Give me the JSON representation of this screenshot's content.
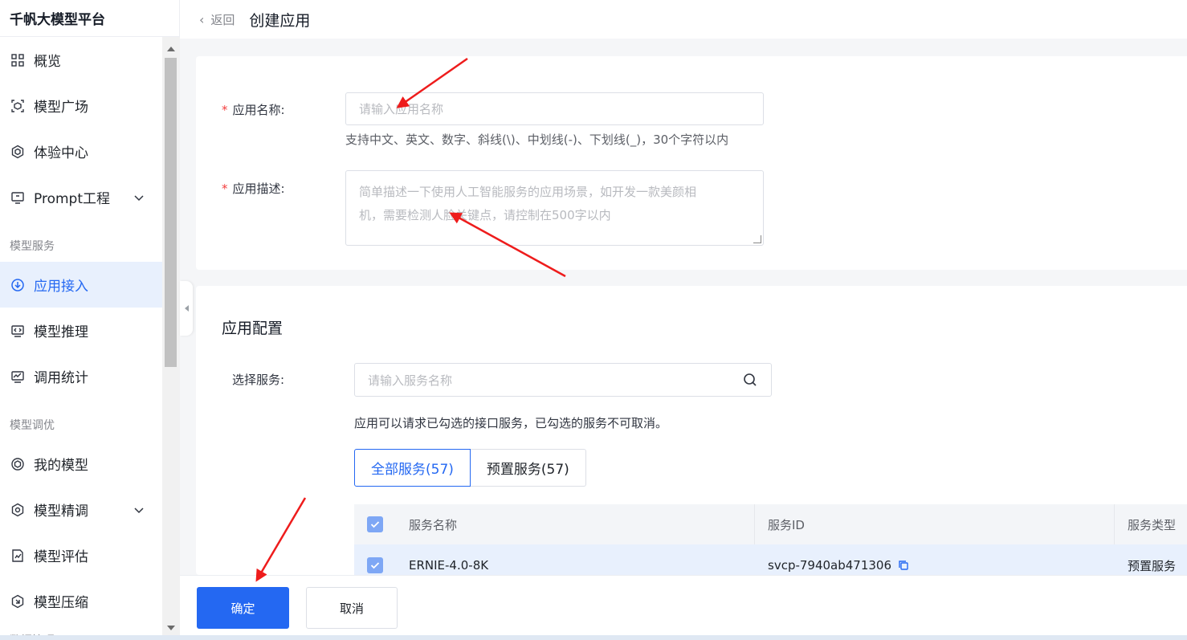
{
  "brand": "千帆大模型平台",
  "sidebar": {
    "items": [
      {
        "label": "概览",
        "icon": "grid-icon"
      },
      {
        "label": "模型广场",
        "icon": "cube-scan-icon"
      },
      {
        "label": "体验中心",
        "icon": "hexagon-icon"
      },
      {
        "label": "Prompt工程",
        "icon": "prompt-icon"
      }
    ],
    "group_service": "模型服务",
    "service_items": [
      {
        "label": "应用接入",
        "icon": "download-circle-icon",
        "active": true
      },
      {
        "label": "模型推理",
        "icon": "code-monitor-icon"
      },
      {
        "label": "调用统计",
        "icon": "chart-monitor-icon"
      }
    ],
    "group_tuning": "模型调优",
    "tuning_items": [
      {
        "label": "我的模型",
        "icon": "model-icon"
      },
      {
        "label": "模型精调",
        "icon": "tune-icon"
      },
      {
        "label": "模型评估",
        "icon": "evaluate-icon"
      },
      {
        "label": "模型压缩",
        "icon": "compress-icon"
      }
    ],
    "group_data": "数据管理"
  },
  "header": {
    "back_label": "返回",
    "title": "创建应用"
  },
  "form": {
    "name_label": "应用名称:",
    "name_placeholder": "请输入应用名称",
    "name_hint": "支持中文、英文、数字、斜线(\\)、中划线(-)、下划线(_)，30个字符以内",
    "desc_label": "应用描述:",
    "desc_placeholder_line1": "简单描述一下使用人工智能服务的应用场景，如开发一款美颜相",
    "desc_placeholder_line2": "机，需要检测人脸关键点，请控制在500字以内"
  },
  "config": {
    "title": "应用配置",
    "service_label": "选择服务:",
    "service_placeholder": "请输入服务名称",
    "service_hint": "应用可以请求已勾选的接口服务，已勾选的服务不可取消。",
    "tabs": [
      "全部服务(57)",
      "预置服务(57)"
    ],
    "table": {
      "headers": [
        "服务名称",
        "服务ID",
        "服务类型"
      ],
      "rows": [
        {
          "name": "ERNIE-4.0-8K",
          "id": "svcp-7940ab471306",
          "type": "预置服务"
        }
      ]
    }
  },
  "footer": {
    "confirm": "确定",
    "cancel": "取消"
  },
  "colors": {
    "primary": "#2468f2",
    "required": "#f33e3e",
    "annotation": "#ee1c1c"
  }
}
